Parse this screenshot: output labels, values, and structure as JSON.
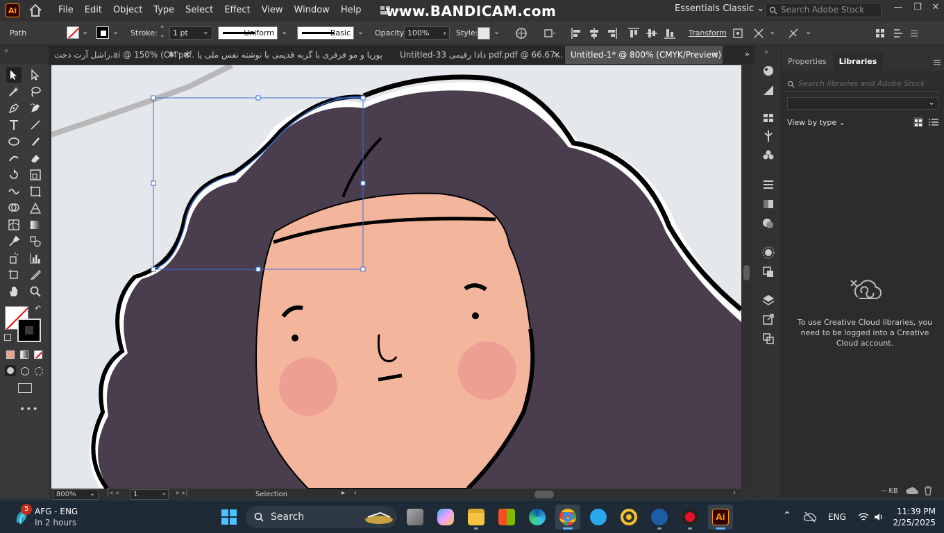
{
  "app": {
    "logo": "Ai",
    "menus": [
      "File",
      "Edit",
      "Object",
      "Type",
      "Select",
      "Effect",
      "View",
      "Window",
      "Help"
    ],
    "watermark": "www.BANDICAM.com",
    "workspace": "Essentials Classic",
    "search_placeholder": "Search Adobe Stock"
  },
  "control_bar": {
    "selection_type": "Path",
    "stroke_label": "Stroke:",
    "stroke_weight": "1 pt",
    "profile": "Uniform",
    "brush": "Basic",
    "opacity_label": "Opacity:",
    "opacity_value": "100%",
    "style_label": "Style:",
    "transform_label": "Transform"
  },
  "tabs": [
    {
      "label": "راشل آرت دخت.ai @ 150% (CMY...",
      "active": false
    },
    {
      "label": "پوریا و مو فرفری با گربه قدیمی با نوشته نفس ملی  یا .pdf",
      "active": false
    },
    {
      "label": "Untitled-33 دادا رقیمی pdf.pdf @ 66.67...",
      "active": false
    },
    {
      "label": "Untitled-1* @ 800% (CMYK/Preview)",
      "active": true
    }
  ],
  "status_bar": {
    "zoom": "800%",
    "artboard": "1",
    "mode": "Selection"
  },
  "right_panel": {
    "tabs": [
      {
        "label": "Properties",
        "active": false
      },
      {
        "label": "Libraries",
        "active": true
      }
    ],
    "search_placeholder": "Search libraries and Adobe Stock",
    "view_by": "View by type",
    "cc_message": "To use Creative Cloud libraries, you need to be logged into a Creative Cloud account.",
    "storage": "-- KB"
  },
  "taskbar": {
    "weather_badge": "5",
    "weather_line1": "AFG - ENG",
    "weather_line2": "In 2 hours",
    "search_label": "Search",
    "lang": "ENG",
    "time": "11:39 PM",
    "date": "2/25/2025"
  },
  "colors": {
    "hair": "#4a3d4d",
    "skin": "#f4b59d",
    "cheek": "#ee9f94",
    "selection": "#3d6fd8",
    "ai_orange": "#ff9a00"
  }
}
